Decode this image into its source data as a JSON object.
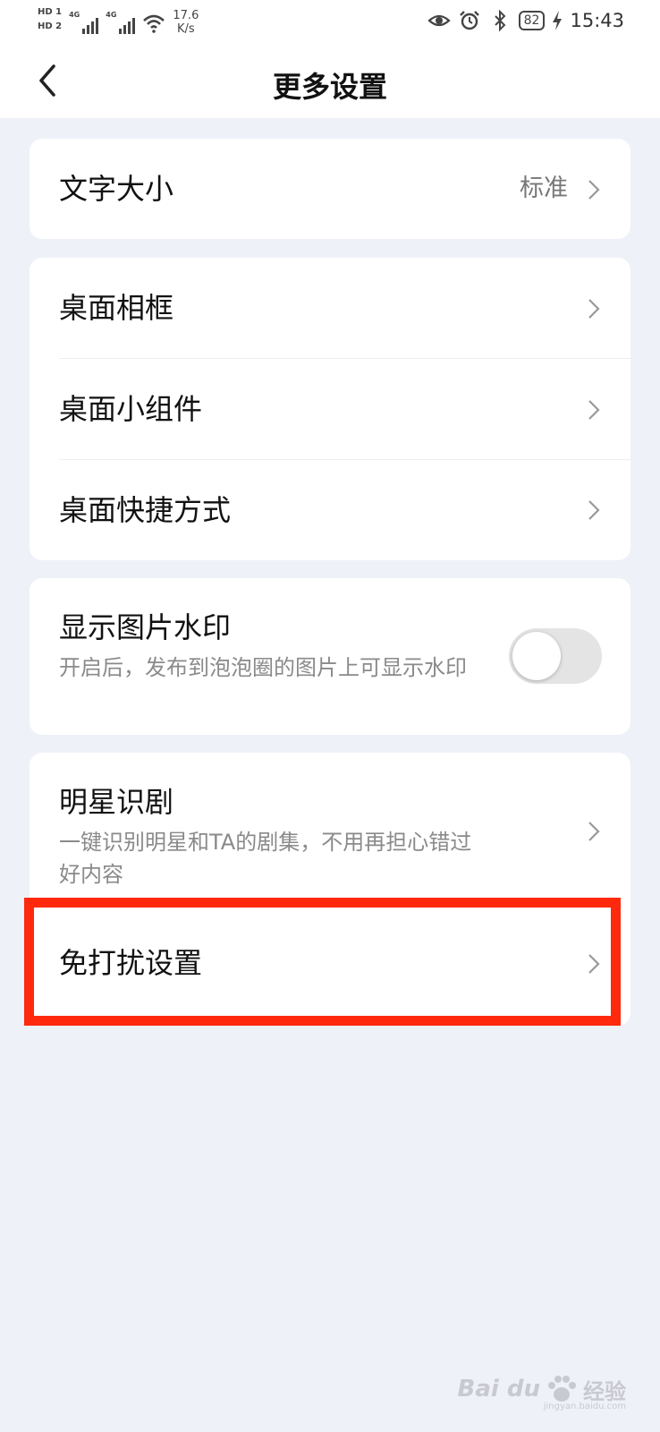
{
  "status_bar": {
    "hd1": "HD 1",
    "hd2": "HD 2",
    "sig1": "4G",
    "sig2": "4G",
    "speed_value": "17.6",
    "speed_unit": "K/s",
    "battery": "82",
    "time": "15:43",
    "icons": [
      "eye-icon",
      "alarm-icon",
      "bluetooth-icon",
      "charging-icon",
      "wifi-icon"
    ]
  },
  "header": {
    "title": "更多设置"
  },
  "text_size": {
    "label": "文字大小",
    "value": "标准"
  },
  "desktop_group": {
    "items": [
      {
        "label": "桌面相框"
      },
      {
        "label": "桌面小组件"
      },
      {
        "label": "桌面快捷方式"
      }
    ]
  },
  "watermark_setting": {
    "title": "显示图片水印",
    "description": "开启后，发布到泡泡圈的图片上可显示水印",
    "enabled": false
  },
  "star_recognition": {
    "title": "明星识剧",
    "description": "一键识别明星和TA的剧集，不用再担心错过好内容"
  },
  "dnd_setting": {
    "label": "免打扰设置"
  },
  "highlight_color": "#ff2a0e",
  "baidu_watermark": {
    "brand": "Bai du",
    "sub": "经验",
    "url": "jingyan.baidu.com"
  }
}
